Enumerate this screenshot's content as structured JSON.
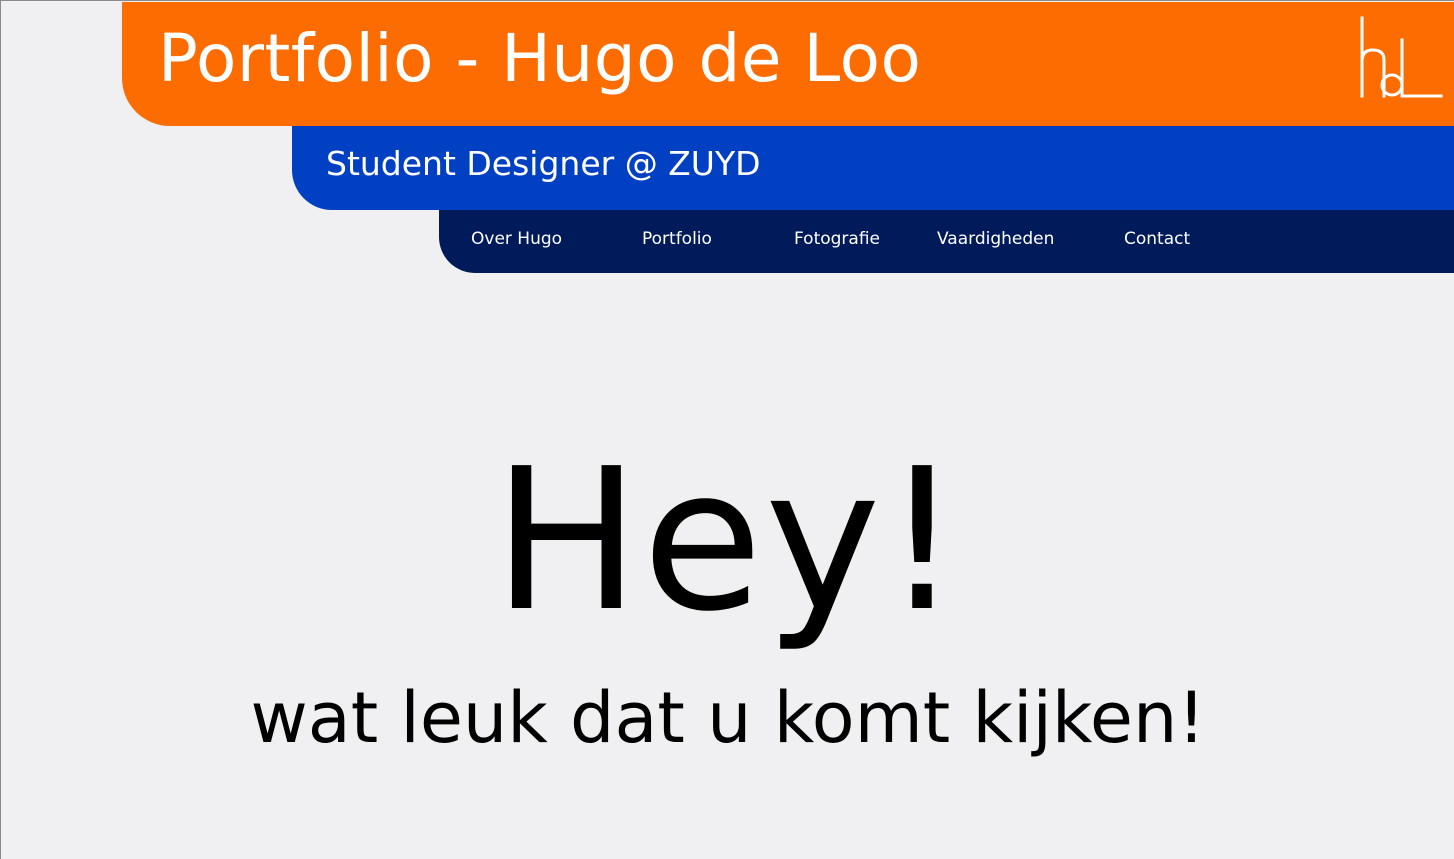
{
  "header": {
    "title": "Portfolio - Hugo de Loo",
    "subtitle": "Student Designer @ ZUYD",
    "logo_icon": "hdl-monogram-icon"
  },
  "nav": {
    "items": [
      {
        "label": "Over Hugo"
      },
      {
        "label": "Portfolio"
      },
      {
        "label": "Fotografie"
      },
      {
        "label": "Vaardigheden"
      },
      {
        "label": "Contact"
      }
    ]
  },
  "hero": {
    "title": "Hey!",
    "subtitle": "wat leuk dat u komt kijken!"
  },
  "colors": {
    "orange": "#fc6c00",
    "blue": "#0240c3",
    "navy": "#001a5a",
    "background": "#f0eff1"
  }
}
